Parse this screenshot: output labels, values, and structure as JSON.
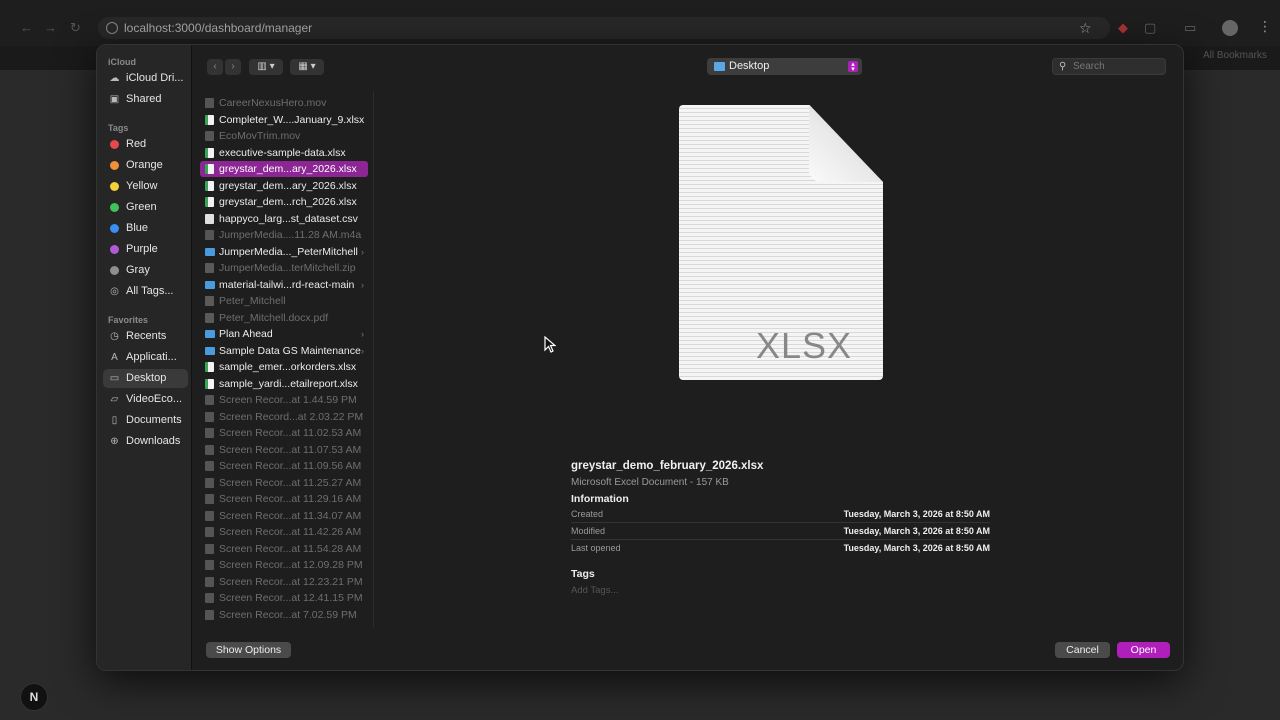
{
  "browser": {
    "url": "localhost:3000/dashboard/manager",
    "bookmarks_label": "All Bookmarks",
    "framework_badge": "N"
  },
  "dialog": {
    "sidebar": {
      "sections": [
        {
          "header": "iCloud",
          "items": [
            {
              "label": "iCloud Dri...",
              "icon": "cloud-icon"
            },
            {
              "label": "Shared",
              "icon": "shared-folder-icon"
            }
          ]
        },
        {
          "header": "Tags",
          "items": [
            {
              "label": "Red",
              "color": "#e5484d"
            },
            {
              "label": "Orange",
              "color": "#f0913a"
            },
            {
              "label": "Yellow",
              "color": "#f2d13a"
            },
            {
              "label": "Green",
              "color": "#3fc25a"
            },
            {
              "label": "Blue",
              "color": "#3b8ff0"
            },
            {
              "label": "Purple",
              "color": "#b05ad6"
            },
            {
              "label": "Gray",
              "color": "#8e8e8e"
            },
            {
              "label": "All Tags...",
              "icon": "all-tags-icon"
            }
          ]
        },
        {
          "header": "Favorites",
          "items": [
            {
              "label": "Recents",
              "icon": "clock-icon"
            },
            {
              "label": "Applicati...",
              "icon": "applications-icon"
            },
            {
              "label": "Desktop",
              "icon": "desktop-icon",
              "active": true
            },
            {
              "label": "VideoEco...",
              "icon": "folder-icon"
            },
            {
              "label": "Documents",
              "icon": "document-icon"
            },
            {
              "label": "Downloads",
              "icon": "download-icon"
            }
          ]
        }
      ]
    },
    "toolbar": {
      "back": "‹",
      "forward": "›",
      "view_columns": "▥ ▾",
      "view_grid": "▦ ▾",
      "location": "Desktop",
      "search_placeholder": "Search"
    },
    "files": [
      {
        "name": "CareerNexusHero.mov",
        "type": "media",
        "dim": true
      },
      {
        "name": "Completer_W....January_9.xlsx",
        "type": "xlsx"
      },
      {
        "name": "EcoMovTrim.mov",
        "type": "media",
        "dim": true
      },
      {
        "name": "executive-sample-data.xlsx",
        "type": "xlsx"
      },
      {
        "name": "greystar_dem...ary_2026.xlsx",
        "type": "xlsx",
        "selected": true
      },
      {
        "name": "greystar_dem...ary_2026.xlsx",
        "type": "xlsx"
      },
      {
        "name": "greystar_dem...rch_2026.xlsx",
        "type": "xlsx"
      },
      {
        "name": "happyco_larg...st_dataset.csv",
        "type": "doc"
      },
      {
        "name": "JumperMedia....11.28 AM.m4a",
        "type": "media",
        "dim": true
      },
      {
        "name": "JumperMedia..._PeterMitchell",
        "type": "folder",
        "folder": true
      },
      {
        "name": "JumperMedia...terMitchell.zip",
        "type": "dimdoc",
        "dim": true
      },
      {
        "name": "material-tailwi...rd-react-main",
        "type": "folder",
        "folder": true
      },
      {
        "name": "Peter_Mitchell",
        "type": "dimdoc",
        "dim": true
      },
      {
        "name": "Peter_Mitchell.docx.pdf",
        "type": "dimdoc",
        "dim": true
      },
      {
        "name": "Plan Ahead",
        "type": "folder",
        "folder": true
      },
      {
        "name": "Sample Data GS Maintenance",
        "type": "folder",
        "folder": true
      },
      {
        "name": "sample_emer...orkorders.xlsx",
        "type": "xlsx"
      },
      {
        "name": "sample_yardi...etailreport.xlsx",
        "type": "xlsx"
      },
      {
        "name": "Screen Recor...at 1.44.59 PM",
        "type": "media",
        "dim": true
      },
      {
        "name": "Screen Record...at 2.03.22 PM",
        "type": "media",
        "dim": true
      },
      {
        "name": "Screen Recor...at 11.02.53 AM",
        "type": "media",
        "dim": true
      },
      {
        "name": "Screen Recor...at 11.07.53 AM",
        "type": "media",
        "dim": true
      },
      {
        "name": "Screen Recor...at 11.09.56 AM",
        "type": "media",
        "dim": true
      },
      {
        "name": "Screen Recor...at 11.25.27 AM",
        "type": "media",
        "dim": true
      },
      {
        "name": "Screen Recor...at 11.29.16 AM",
        "type": "media",
        "dim": true
      },
      {
        "name": "Screen Recor...at 11.34.07 AM",
        "type": "media",
        "dim": true
      },
      {
        "name": "Screen Recor...at 11.42.26 AM",
        "type": "media",
        "dim": true
      },
      {
        "name": "Screen Recor...at 11.54.28 AM",
        "type": "media",
        "dim": true
      },
      {
        "name": "Screen Recor...at 12.09.28 PM",
        "type": "media",
        "dim": true
      },
      {
        "name": "Screen Recor...at 12.23.21 PM",
        "type": "media",
        "dim": true
      },
      {
        "name": "Screen Recor...at 12.41.15 PM",
        "type": "media",
        "dim": true
      },
      {
        "name": "Screen Recor...at 7.02.59 PM",
        "type": "media",
        "dim": true
      }
    ],
    "preview": {
      "thumb_label": "XLSX",
      "name": "greystar_demo_february_2026.xlsx",
      "kind": "Microsoft Excel Document - 157 KB",
      "info_heading": "Information",
      "info": [
        {
          "key": "Created",
          "value": "Tuesday, March 3, 2026 at 8:50 AM"
        },
        {
          "key": "Modified",
          "value": "Tuesday, March 3, 2026 at 8:50 AM"
        },
        {
          "key": "Last opened",
          "value": "Tuesday, March 3, 2026 at 8:50 AM"
        }
      ],
      "tags_heading": "Tags",
      "tags_placeholder": "Add Tags..."
    },
    "footer": {
      "show_options": "Show Options",
      "cancel": "Cancel",
      "open": "Open"
    },
    "colors": {
      "accent": "#b01ebc",
      "selection": "#8b2694"
    }
  }
}
